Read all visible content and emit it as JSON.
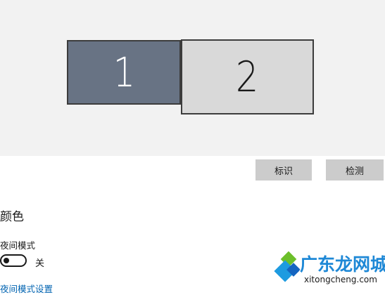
{
  "display": {
    "monitors": [
      {
        "label": "1",
        "selected": true
      },
      {
        "label": "2",
        "selected": false
      }
    ],
    "identify_label": "标识",
    "detect_label": "检测"
  },
  "color": {
    "section_title": "颜色",
    "night_light_label": "夜间模式",
    "night_light_state": "关",
    "night_light_on": false,
    "settings_link": "夜间模式设置"
  },
  "watermark": {
    "brand": "广东龙网城",
    "url": "xitongcheng.com"
  },
  "colors": {
    "monitor_selected": "#687384",
    "monitor_unselected": "#d9d9d9",
    "link": "#0063b1",
    "button_bg": "#cccccc"
  }
}
